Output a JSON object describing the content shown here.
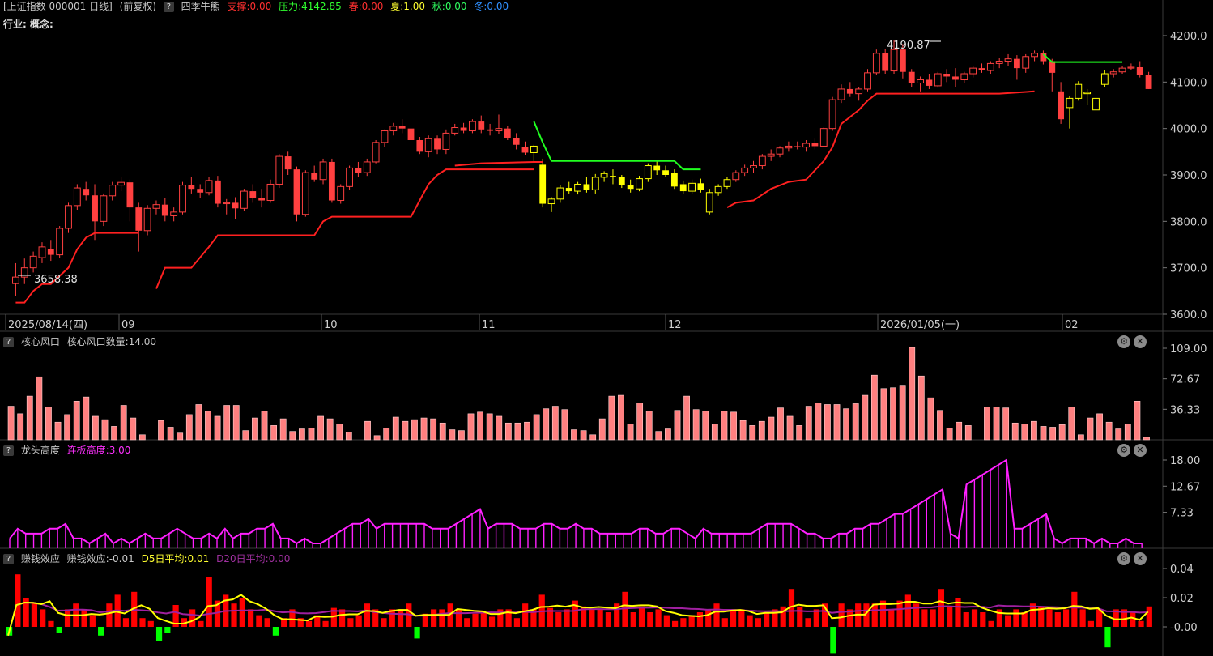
{
  "main_header": {
    "symbol": "[上证指数 000001 日线]",
    "adjust": "(前复权)",
    "indicator": "四季牛熊",
    "support": "支撑:0.00",
    "pressure": "压力:4142.85",
    "spring": "春:0.00",
    "summer": "夏:1.00",
    "autumn": "秋:0.00",
    "winter": "冬:0.00"
  },
  "sub_header": "行业: 概念:",
  "colors": {
    "up": "#ff4040",
    "down": "#00c0c0",
    "support": "#ff2020",
    "pressure": "#20ff20",
    "summer": "#ffff00",
    "magenta": "#ff20ff",
    "green": "#00ff00"
  },
  "price_labels": {
    "high": "4190.87",
    "low": "3658.38"
  },
  "price_axis": [
    "4200.0",
    "4100.0",
    "4000.0",
    "3900.0",
    "3800.0",
    "3700.0",
    "3600.0"
  ],
  "date_axis": [
    "2025/08/14(四)",
    "09",
    "10",
    "11",
    "12",
    "2026/01/05(一)",
    "02"
  ],
  "panel1": {
    "title": "核心风口",
    "value": "核心风口数量:14.00",
    "axis": [
      "109.00",
      "72.67",
      "36.33"
    ]
  },
  "panel2": {
    "title": "龙头高度",
    "value": "连板高度:3.00",
    "axis": [
      "18.00",
      "12.67",
      "7.33"
    ]
  },
  "panel3": {
    "title": "赚钱效应",
    "value": "赚钱效应:-0.01",
    "d5": "D5日平均:0.01",
    "d20": "D20日平均:0.00",
    "axis": [
      "0.04",
      "0.02",
      "-0.00"
    ]
  },
  "controls": {
    "help": "?",
    "gear": "⚙",
    "close": "✕"
  },
  "chart_data": [
    {
      "type": "candlestick",
      "ylim": [
        3600,
        4200
      ],
      "ohlc": [
        [
          3666,
          3710,
          3640,
          3680
        ],
        [
          3680,
          3720,
          3665,
          3700
        ],
        [
          3700,
          3735,
          3690,
          3725
        ],
        [
          3722,
          3755,
          3710,
          3745
        ],
        [
          3740,
          3760,
          3715,
          3728
        ],
        [
          3728,
          3790,
          3722,
          3785
        ],
        [
          3785,
          3840,
          3775,
          3834
        ],
        [
          3834,
          3880,
          3825,
          3872
        ],
        [
          3870,
          3885,
          3845,
          3856
        ],
        [
          3856,
          3880,
          3760,
          3800
        ],
        [
          3800,
          3860,
          3790,
          3855
        ],
        [
          3855,
          3885,
          3845,
          3878
        ],
        [
          3878,
          3895,
          3865,
          3884
        ],
        [
          3884,
          3890,
          3800,
          3830
        ],
        [
          3830,
          3840,
          3735,
          3780
        ],
        [
          3780,
          3835,
          3770,
          3828
        ],
        [
          3828,
          3845,
          3815,
          3836
        ],
        [
          3836,
          3850,
          3800,
          3812
        ],
        [
          3812,
          3830,
          3800,
          3820
        ],
        [
          3820,
          3885,
          3815,
          3878
        ],
        [
          3878,
          3895,
          3860,
          3870
        ],
        [
          3870,
          3880,
          3850,
          3862
        ],
        [
          3862,
          3895,
          3856,
          3888
        ],
        [
          3888,
          3898,
          3830,
          3838
        ],
        [
          3838,
          3848,
          3815,
          3840
        ],
        [
          3840,
          3852,
          3805,
          3828
        ],
        [
          3828,
          3870,
          3822,
          3865
        ],
        [
          3865,
          3880,
          3840,
          3850
        ],
        [
          3850,
          3870,
          3830,
          3845
        ],
        [
          3845,
          3890,
          3840,
          3880
        ],
        [
          3880,
          3945,
          3872,
          3940
        ],
        [
          3940,
          3950,
          3900,
          3912
        ],
        [
          3912,
          3918,
          3800,
          3815
        ],
        [
          3815,
          3910,
          3810,
          3905
        ],
        [
          3905,
          3920,
          3885,
          3890
        ],
        [
          3890,
          3935,
          3880,
          3928
        ],
        [
          3928,
          3935,
          3840,
          3845
        ],
        [
          3845,
          3880,
          3838,
          3875
        ],
        [
          3875,
          3920,
          3868,
          3915
        ],
        [
          3915,
          3928,
          3895,
          3905
        ],
        [
          3905,
          3935,
          3898,
          3928
        ],
        [
          3928,
          3975,
          3925,
          3970
        ],
        [
          3970,
          3998,
          3960,
          3995
        ],
        [
          3995,
          4012,
          3985,
          4005
        ],
        [
          4005,
          4020,
          3990,
          4000
        ],
        [
          4000,
          4025,
          3970,
          3975
        ],
        [
          3975,
          3982,
          3945,
          3950
        ],
        [
          3950,
          3985,
          3938,
          3978
        ],
        [
          3978,
          3985,
          3945,
          3955
        ],
        [
          3955,
          3998,
          3945,
          3990
        ],
        [
          3990,
          4010,
          3985,
          4002
        ],
        [
          4002,
          4012,
          3990,
          3995
        ],
        [
          3995,
          4020,
          3990,
          4015
        ],
        [
          4015,
          4028,
          3990,
          3998
        ],
        [
          3998,
          4010,
          3985,
          3995
        ],
        [
          3995,
          4030,
          3988,
          4000
        ],
        [
          4000,
          4005,
          3975,
          3980
        ],
        [
          3980,
          3990,
          3955,
          3965
        ],
        [
          3960,
          3972,
          3942,
          3948
        ],
        [
          3948,
          3965,
          3930,
          3962
        ],
        [
          3922,
          3935,
          3830,
          3838
        ],
        [
          3838,
          3852,
          3820,
          3848
        ],
        [
          3848,
          3878,
          3840,
          3872
        ],
        [
          3872,
          3885,
          3860,
          3865
        ],
        [
          3865,
          3885,
          3858,
          3880
        ],
        [
          3880,
          3895,
          3862,
          3868
        ],
        [
          3868,
          3902,
          3860,
          3895
        ],
        [
          3895,
          3908,
          3885,
          3903
        ],
        [
          3898,
          3912,
          3880,
          3895
        ],
        [
          3895,
          3900,
          3872,
          3878
        ],
        [
          3878,
          3890,
          3862,
          3870
        ],
        [
          3870,
          3898,
          3865,
          3892
        ],
        [
          3892,
          3925,
          3885,
          3920
        ],
        [
          3920,
          3930,
          3900,
          3910
        ],
        [
          3910,
          3920,
          3895,
          3900
        ],
        [
          3905,
          3912,
          3870,
          3875
        ],
        [
          3880,
          3888,
          3860,
          3865
        ],
        [
          3865,
          3890,
          3858,
          3882
        ],
        [
          3882,
          3892,
          3862,
          3868
        ],
        [
          3820,
          3870,
          3815,
          3862
        ],
        [
          3862,
          3880,
          3855,
          3875
        ],
        [
          3875,
          3895,
          3870,
          3890
        ],
        [
          3890,
          3910,
          3885,
          3905
        ],
        [
          3905,
          3922,
          3898,
          3915
        ],
        [
          3915,
          3930,
          3905,
          3920
        ],
        [
          3920,
          3945,
          3912,
          3940
        ],
        [
          3940,
          3955,
          3930,
          3945
        ],
        [
          3945,
          3962,
          3938,
          3958
        ],
        [
          3958,
          3972,
          3950,
          3962
        ],
        [
          3962,
          3972,
          3955,
          3960
        ],
        [
          3960,
          3975,
          3950,
          3968
        ],
        [
          3968,
          3978,
          3955,
          3962
        ],
        [
          3962,
          4002,
          3960,
          4000
        ],
        [
          4000,
          4068,
          3995,
          4062
        ],
        [
          4062,
          4095,
          4055,
          4085
        ],
        [
          4085,
          4100,
          4068,
          4075
        ],
        [
          4075,
          4090,
          4060,
          4085
        ],
        [
          4085,
          4128,
          4080,
          4120
        ],
        [
          4120,
          4170,
          4115,
          4162
        ],
        [
          4162,
          4172,
          4118,
          4124
        ],
        [
          4124,
          4190.87,
          4118,
          4170
        ],
        [
          4170,
          4182,
          4108,
          4122
        ],
        [
          4122,
          4128,
          4090,
          4098
        ],
        [
          4098,
          4112,
          4080,
          4105
        ],
        [
          4105,
          4118,
          4085,
          4092
        ],
        [
          4092,
          4122,
          4088,
          4118
        ],
        [
          4118,
          4128,
          4100,
          4112
        ],
        [
          4112,
          4130,
          4090,
          4105
        ],
        [
          4105,
          4122,
          4098,
          4118
        ],
        [
          4118,
          4135,
          4110,
          4130
        ],
        [
          4130,
          4140,
          4120,
          4125
        ],
        [
          4125,
          4145,
          4118,
          4140
        ],
        [
          4140,
          4152,
          4130,
          4145
        ],
        [
          4145,
          4160,
          4135,
          4150
        ],
        [
          4150,
          4158,
          4105,
          4130
        ],
        [
          4130,
          4160,
          4120,
          4155
        ],
        [
          4155,
          4168,
          4145,
          4162
        ],
        [
          4162,
          4168,
          4138,
          4145
        ],
        [
          4145,
          4150,
          4080,
          4120
        ],
        [
          4080,
          4100,
          4010,
          4020
        ],
        [
          4045,
          4070,
          4000,
          4065
        ],
        [
          4065,
          4102,
          4060,
          4095
        ],
        [
          4075,
          4085,
          4050,
          4078
        ],
        [
          4040,
          4070,
          4032,
          4065
        ],
        [
          4095,
          4125,
          4090,
          4118
        ],
        [
          4118,
          4128,
          4110,
          4122
        ],
        [
          4122,
          4135,
          4118,
          4130
        ],
        [
          4130,
          4140,
          4125,
          4132
        ],
        [
          4132,
          4145,
          4110,
          4115
        ],
        [
          4115,
          4122,
          4085,
          4085
        ]
      ]
    },
    {
      "type": "bar",
      "title": "核心风口",
      "ylim": [
        0,
        109
      ],
      "values": [
        40,
        31,
        52,
        75,
        39,
        21,
        30,
        46,
        51,
        28,
        24,
        16,
        41,
        26,
        6,
        0,
        23,
        15,
        8,
        30,
        42,
        34,
        28,
        41,
        41,
        11,
        26,
        34,
        17,
        25,
        10,
        13,
        14,
        28,
        25,
        19,
        9,
        0,
        22,
        5,
        14,
        27,
        22,
        24,
        26,
        25,
        20,
        12,
        11,
        31,
        33,
        31,
        28,
        20,
        20,
        21,
        30,
        37,
        40,
        36,
        12,
        11,
        6,
        25,
        52,
        53,
        19,
        44,
        34,
        10,
        13,
        35,
        52,
        36,
        34,
        19,
        34,
        33,
        23,
        17,
        22,
        27,
        38,
        28,
        17,
        40,
        44,
        42,
        42,
        37,
        43,
        53,
        77,
        61,
        62,
        65,
        110,
        76,
        50,
        35,
        14,
        21,
        17,
        0,
        39,
        39,
        38,
        20,
        19,
        22,
        16,
        15,
        18,
        39,
        6,
        26,
        31,
        21,
        13,
        19,
        46,
        3
      ],
      "colors": [
        "pink",
        "green"
      ]
    },
    {
      "type": "bar",
      "title": "龙头高度",
      "ylim": [
        0,
        18
      ],
      "values": [
        2,
        4,
        3,
        3,
        3,
        4,
        4,
        5,
        2,
        2,
        1,
        2,
        3,
        1,
        2,
        1,
        2,
        3,
        2,
        2,
        3,
        4,
        3,
        2,
        2,
        3,
        2,
        4,
        2,
        3,
        3,
        4,
        4,
        5,
        2,
        2,
        1,
        2,
        1,
        1,
        2,
        3,
        4,
        5,
        5,
        6,
        4,
        5,
        5,
        5,
        5,
        5,
        5,
        4,
        4,
        4,
        5,
        6,
        7,
        8,
        4,
        5,
        5,
        5,
        4,
        4,
        4,
        5,
        5,
        4,
        4,
        5,
        4,
        4,
        3,
        3,
        3,
        3,
        3,
        4,
        4,
        3,
        3,
        4,
        4,
        3,
        2,
        4,
        3,
        3,
        3,
        3,
        3,
        3,
        4,
        5,
        5,
        5,
        5,
        4,
        3,
        3,
        2,
        2,
        3,
        3,
        4,
        4,
        5,
        5,
        6,
        7,
        7,
        8,
        9,
        10,
        11,
        12,
        3,
        2,
        13,
        14,
        15,
        16,
        17,
        18,
        4,
        4,
        5,
        6,
        7,
        2,
        1,
        2,
        2,
        2,
        1,
        2,
        1,
        1,
        2,
        1,
        1
      ],
      "colors": [
        "magenta"
      ]
    },
    {
      "type": "bar",
      "title": "赚钱效应",
      "ylim": [
        -0.02,
        0.04
      ],
      "values": [
        -0.006,
        0.036,
        0.02,
        0.016,
        0.012,
        0.004,
        -0.004,
        0.012,
        0.016,
        0.012,
        0.008,
        -0.006,
        0.016,
        0.022,
        0.006,
        0.024,
        0.006,
        0.004,
        -0.01,
        -0.004,
        0.015,
        0.006,
        0.012,
        0.004,
        0.034,
        0.018,
        0.022,
        0.016,
        0.02,
        0.012,
        0.008,
        0.006,
        -0.006,
        0.006,
        0.012,
        0.006,
        0.004,
        0.008,
        0.004,
        0.013,
        0.012,
        0.006,
        0.008,
        0.016,
        0.012,
        0.006,
        0.012,
        0.012,
        0.016,
        -0.008,
        0.009,
        0.012,
        0.012,
        0.016,
        0.012,
        0.006,
        0.009,
        0.01,
        0.007,
        0.012,
        0.012,
        0.006,
        0.016,
        0.012,
        0.022,
        0.013,
        0.01,
        0.012,
        0.018,
        0.014,
        0.012,
        0.012,
        0.01,
        0.016,
        0.024,
        0.01,
        0.014,
        0.01,
        0.012,
        0.008,
        0.004,
        0.006,
        0.008,
        0.01,
        0.012,
        0.016,
        0.006,
        0.012,
        0.012,
        0.008,
        0.006,
        0.01,
        0.012,
        0.014,
        0.026,
        0.014,
        0.006,
        0.012,
        0.016,
        -0.018,
        0.016,
        0.012,
        0.016,
        0.016,
        0.016,
        0.018,
        0.012,
        0.018,
        0.022,
        0.016,
        0.012,
        0.012,
        0.026,
        0.014,
        0.02,
        0.01,
        0.012,
        0.01,
        0.004,
        0.012,
        0.008,
        0.012,
        0.01,
        0.016,
        0.014,
        0.012,
        0.01,
        0.012,
        0.024,
        0.012,
        0.004,
        0.012,
        -0.014,
        0.012,
        0.012,
        0.01,
        0.004,
        0.014
      ],
      "colors": [
        "red",
        "green"
      ]
    }
  ]
}
